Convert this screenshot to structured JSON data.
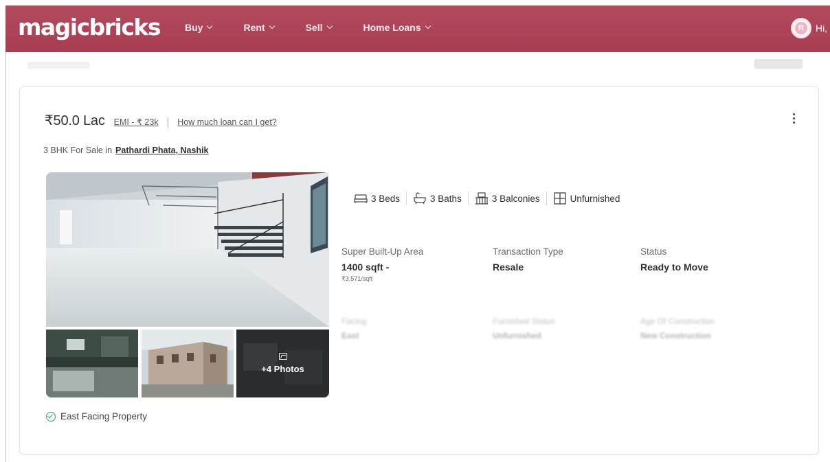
{
  "header": {
    "logo": "magicbricks",
    "nav": [
      {
        "label": "Buy"
      },
      {
        "label": "Rent"
      },
      {
        "label": "Sell"
      },
      {
        "label": "Home Loans"
      }
    ],
    "avatar_initial": "R",
    "greeting": "Hi,"
  },
  "listing": {
    "price": "₹50.0 Lac",
    "emi": "EMI - ₹ 23k",
    "separator": "|",
    "loan_link": "How much loan can I get?",
    "title_prefix": "3 BHK For Sale in",
    "location": "Pathardi Phata, Nashik",
    "more_photos": "+4 Photos",
    "facing_badge": "East Facing Property",
    "amenities": [
      {
        "icon": "bed-icon",
        "label": "3 Beds"
      },
      {
        "icon": "bath-icon",
        "label": "3 Baths"
      },
      {
        "icon": "balcony-icon",
        "label": "3 Balconies"
      },
      {
        "icon": "window-icon",
        "label": "Unfurnished"
      }
    ],
    "summary": [
      {
        "label": "Super Built-Up Area",
        "value": "1400 sqft -",
        "sub": "₹3,571/sqft"
      },
      {
        "label": "Transaction Type",
        "value": "Resale"
      },
      {
        "label": "Status",
        "value": "Ready to Move"
      }
    ],
    "summary_blurred": [
      {
        "label": "Facing",
        "value": "East"
      },
      {
        "label": "Furnished Status",
        "value": "Unfurnished"
      },
      {
        "label": "Age Of Construction",
        "value": "New Construction"
      }
    ]
  },
  "colors": {
    "brand": "#a83d52",
    "check": "#2fa36b"
  }
}
